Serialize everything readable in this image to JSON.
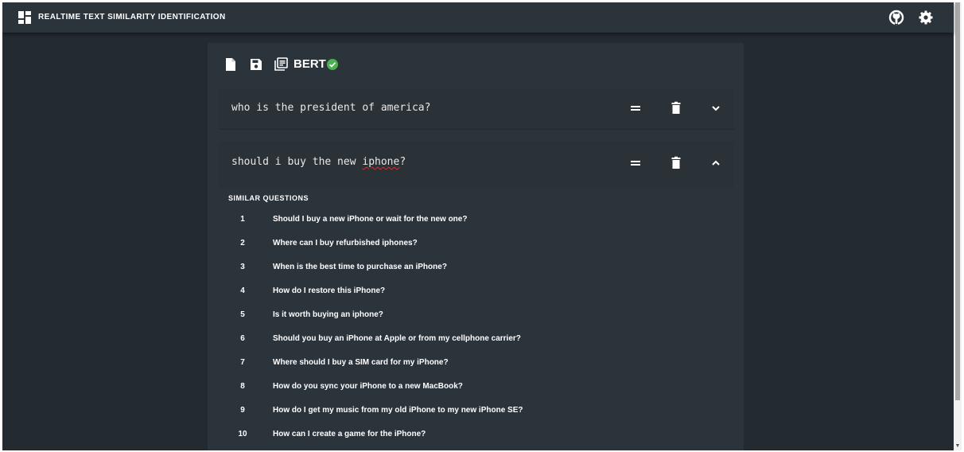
{
  "app": {
    "title": "REALTIME TEXT SIMILARITY IDENTIFICATION",
    "logo_icon": "dashboard-icon",
    "actions": [
      "github-icon",
      "settings-icon"
    ]
  },
  "toolbar": {
    "icons": [
      "new-file-icon",
      "save-icon",
      "library-books-icon"
    ],
    "model": "BERT",
    "model_status_icon": "check-circle-icon",
    "model_status_color": "#4caf50"
  },
  "questions": [
    {
      "text": "who is the president of america?",
      "expanded": false
    },
    {
      "text_before": "should i buy the new ",
      "text_misspelled": "iphone",
      "text_after": "?",
      "expanded": true
    }
  ],
  "similar": {
    "heading": "SIMILAR QUESTIONS",
    "items": [
      {
        "num": "1",
        "text": "Should I buy a new iPhone or wait for the new one?"
      },
      {
        "num": "2",
        "text": "Where can I buy refurbished iphones?"
      },
      {
        "num": "3",
        "text": "When is the best time to purchase an iPhone?"
      },
      {
        "num": "4",
        "text": "How do I restore this iPhone?"
      },
      {
        "num": "5",
        "text": "Is it worth buying an iphone?"
      },
      {
        "num": "6",
        "text": "Should you buy an iPhone at Apple or from my cellphone carrier?"
      },
      {
        "num": "7",
        "text": "Where should I buy a SIM card for my iPhone?"
      },
      {
        "num": "8",
        "text": "How do you sync your iPhone to a new MacBook?"
      },
      {
        "num": "9",
        "text": "How do I get my music from my old iPhone to my new iPhone SE?"
      },
      {
        "num": "10",
        "text": "How can I create a game for the iPhone?"
      }
    ]
  },
  "colors": {
    "background": "#232a30",
    "panel": "#2c343b",
    "appbar": "#2c343b",
    "accent_check": "#4caf50"
  }
}
